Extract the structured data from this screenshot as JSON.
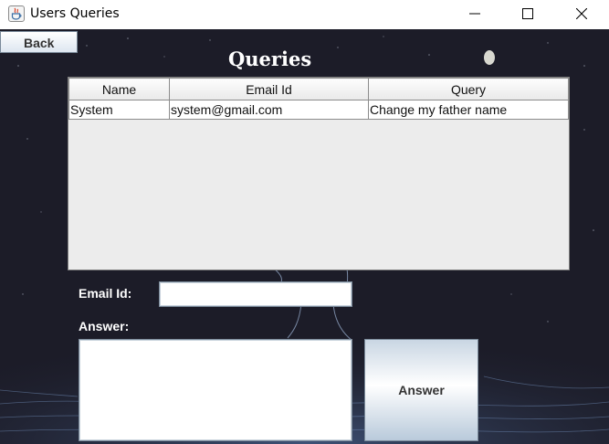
{
  "window": {
    "title": "Users Queries",
    "icon": "java-cup-icon",
    "controls": [
      "minimize-icon",
      "maximize-icon",
      "close-icon"
    ]
  },
  "back_button": {
    "label": "Back"
  },
  "heading": "Queries",
  "table": {
    "columns": [
      "Name",
      "Email Id",
      "Query"
    ],
    "rows": [
      [
        "System",
        "system@gmail.com",
        "Change my father name"
      ]
    ]
  },
  "form": {
    "email_label": "Email Id:",
    "email_value": "",
    "answer_label": "Answer:",
    "answer_value": "",
    "answer_button": "Answer"
  },
  "colors": {
    "background": "#1c1c28",
    "table_bg": "#ececec",
    "label_text": "#ffffff",
    "button_gradient": "#dde6f0"
  }
}
